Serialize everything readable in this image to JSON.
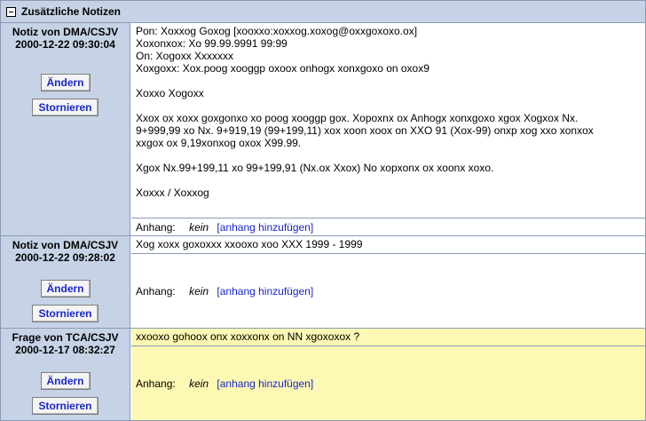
{
  "panel": {
    "title": "Zusätzliche Notizen"
  },
  "buttons": {
    "edit": "Ändern",
    "cancel": "Stornieren"
  },
  "attachment": {
    "label": "Anhang:",
    "none": "kein",
    "add": "[anhang hinzufügen]"
  },
  "entries": [
    {
      "type_author": "Notiz von DMA/CSJV",
      "datetime": "2000-12-22 09:30:04",
      "header_lines": [
        "Pon: Xoxxog Goxog [xooxxo:xoxxog.xoxog@oxxgoxoxo.ox]",
        "Xoxonxox: Xo 99.99.9991 99:99",
        "On: Xogoxx Xxxxxxx",
        "Xoxgoxx: Xox.poog xooggp oxoox onhogx xonxgoxo on oxox9"
      ],
      "greeting": "Xoxxo Xogoxx",
      "para1_lines": [
        "Xxox ox xoxx goxgonxo xo poog xooggp gox. Xopoxnx ox Anhogx xonxgoxo xgox Xogxox Nx.",
        "9+999,99 xo Nx. 9+919,19 (99+199,11) xox xoon xoox on XXO 91 (Xox-99) onxp xog xxo xonxox",
        "xxgox ox 9,19xonxog oxox X99.99."
      ],
      "para2": "Xgox Nx.99+199,11 xo 99+199,91 (Nx.ox Xxox) No xopxonx ox xoonx xoxo.",
      "sign": "Xoxxx / Xoxxog"
    },
    {
      "type_author": "Notiz von DMA/CSJV",
      "datetime": "2000-12-22 09:28:02",
      "text": "Xog xoxx goxoxxx xxooxo xoo XXX 1999 - 1999"
    },
    {
      "type_author": "Frage von TCA/CSJV",
      "datetime": "2000-12-17 08:32:27",
      "text": "xxooxo gohoox onx xoxxonx on NN xgoxoxox ?"
    }
  ],
  "colors": {
    "left_bg": "#c6d3e6",
    "question_bg": "#fdf8b3",
    "link": "#1a27c9",
    "border": "#8a9ab3"
  }
}
